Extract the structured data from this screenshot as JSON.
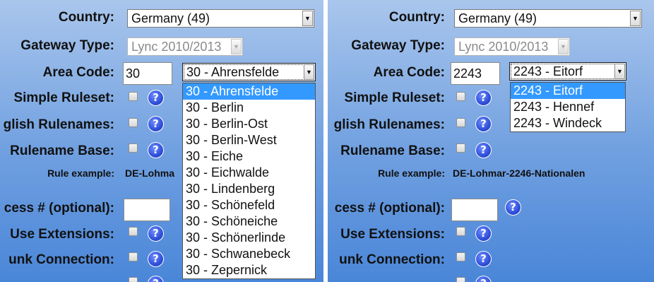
{
  "labels": {
    "country": "Country:",
    "gateway_type": "Gateway Type:",
    "area_code": "Area Code:",
    "simple_ruleset": "Simple Ruleset:",
    "english_rulenames_left": "glish Rulenames:",
    "english_rulenames_right": "glish Rulenames:",
    "rulename_base": "Rulename Base:",
    "rule_example": "Rule example:",
    "access_left": "cess # (optional):",
    "access_right": "cess # (optional):",
    "use_extensions": "Use Extensions:",
    "trunk_left": "unk Connection:",
    "trunk_right": "unk Connection:"
  },
  "left": {
    "country_value": "Germany (49)",
    "gateway_value": "Lync 2010/2013",
    "area_code_input": "30",
    "area_code_select": "30 - Ahrensfelde",
    "rule_example_value": "DE-Lohma",
    "dropdown_options": [
      "30 - Ahrensfelde",
      "30 - Berlin",
      "30 - Berlin-Ost",
      "30 - Berlin-West",
      "30 - Eiche",
      "30 - Eichwalde",
      "30 - Lindenberg",
      "30 - Schönefeld",
      "30 - Schöneiche",
      "30 - Schönerlinde",
      "30 - Schwanebeck",
      "30 - Zepernick"
    ],
    "selected_index": 0
  },
  "right": {
    "country_value": "Germany (49)",
    "gateway_value": "Lync 2010/2013",
    "area_code_input": "2243",
    "area_code_select": "2243 - Eitorf",
    "rule_example_value": "DE-Lohmar-2246-Nationalen",
    "dropdown_options": [
      "2243 - Eitorf",
      "2243 - Hennef",
      "2243 - Windeck"
    ],
    "selected_index": 0
  },
  "icons": {
    "help": "?",
    "dropdown_arrow": "▼"
  },
  "colors": {
    "background_top": "#a9c6ec",
    "background_bottom": "#4a86d8",
    "selection": "#3399ff",
    "help_icon": "#2f4fd9"
  }
}
